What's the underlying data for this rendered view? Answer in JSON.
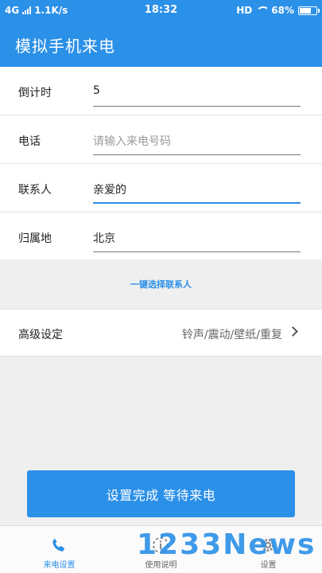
{
  "status_bar": {
    "network": "4G",
    "speed": "1.1K/s",
    "time": "18:32",
    "hd": "HD",
    "battery": "68%"
  },
  "app_bar": {
    "title": "模拟手机来电"
  },
  "form": {
    "countdown": {
      "label": "倒计时",
      "value": "5"
    },
    "phone": {
      "label": "电话",
      "placeholder": "请输入来电号码"
    },
    "contact": {
      "label": "联系人",
      "value": "亲爱的"
    },
    "location": {
      "label": "归属地",
      "value": "北京"
    }
  },
  "quick_select": "一键选择联系人",
  "advanced": {
    "label": "高级设定",
    "value": "铃声/震动/壁纸/重复"
  },
  "primary_button": "设置完成 等待来电",
  "tabs": [
    {
      "label": "来电设置",
      "icon": "phone-icon",
      "active": true
    },
    {
      "label": "使用说明",
      "icon": "info-icon",
      "active": false
    },
    {
      "label": "设置",
      "icon": "gear-icon",
      "active": false
    }
  ],
  "watermark": "1233News",
  "colors": {
    "accent": "#2b90e8",
    "background": "#efefef"
  }
}
